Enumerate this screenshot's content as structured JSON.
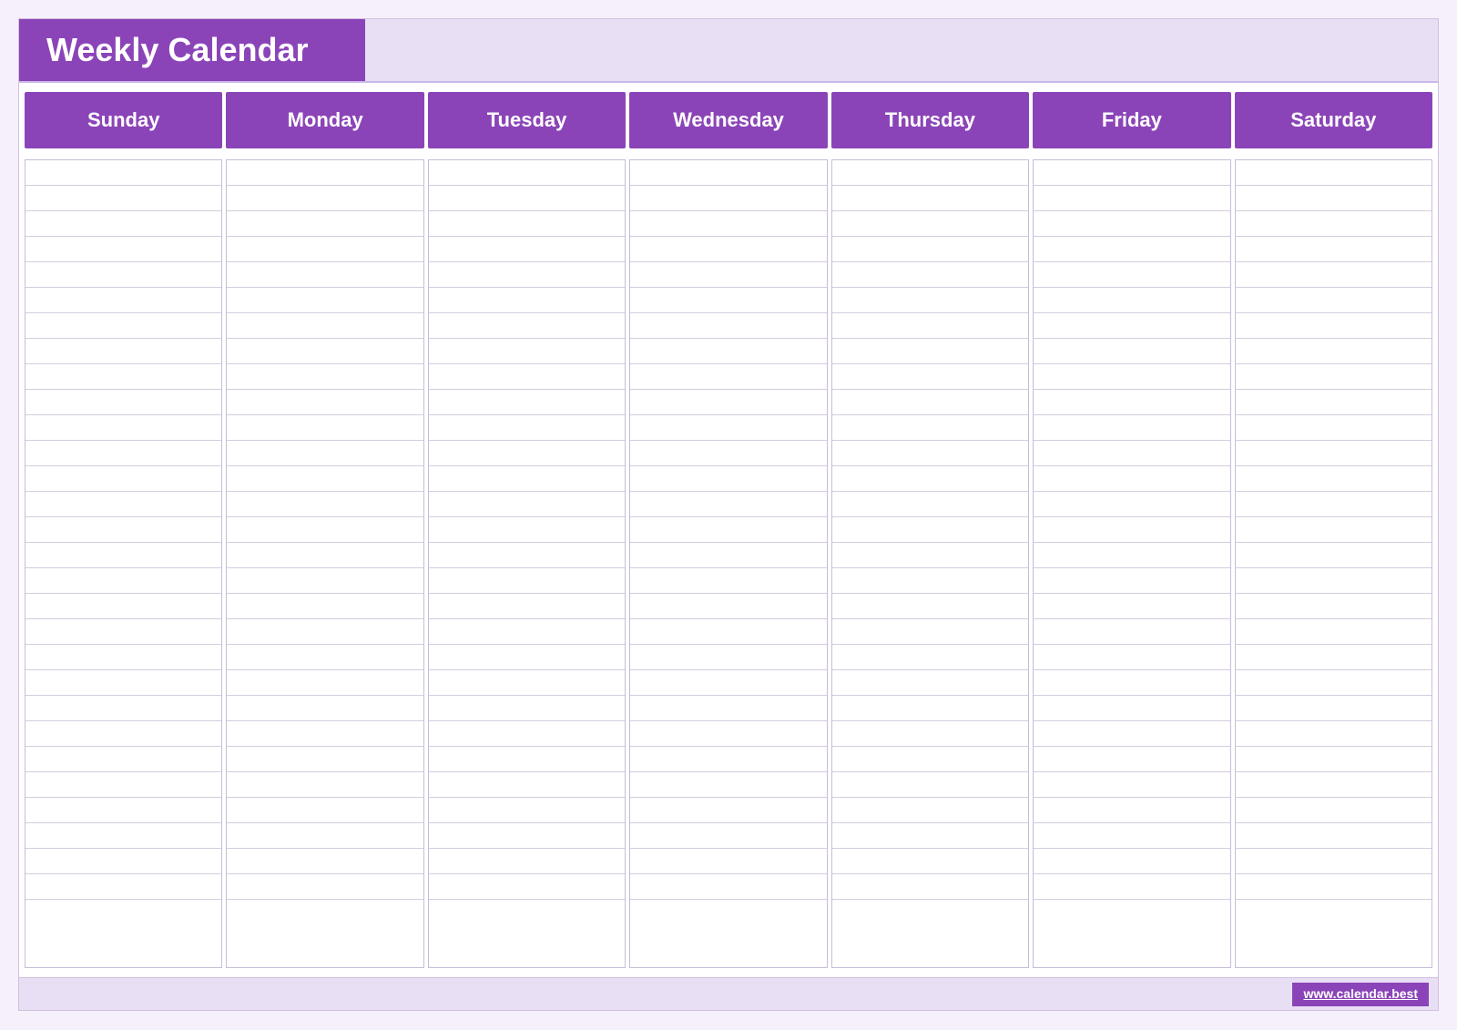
{
  "header": {
    "title": "Weekly Calendar",
    "accent_color": "#8B44B8",
    "bg_color": "#e8dff5"
  },
  "days": [
    {
      "label": "Sunday"
    },
    {
      "label": "Monday"
    },
    {
      "label": "Tuesday"
    },
    {
      "label": "Wednesday"
    },
    {
      "label": "Thursday"
    },
    {
      "label": "Friday"
    },
    {
      "label": "Saturday"
    }
  ],
  "footer": {
    "url": "www.calendar.best"
  },
  "lines_per_day": 30
}
